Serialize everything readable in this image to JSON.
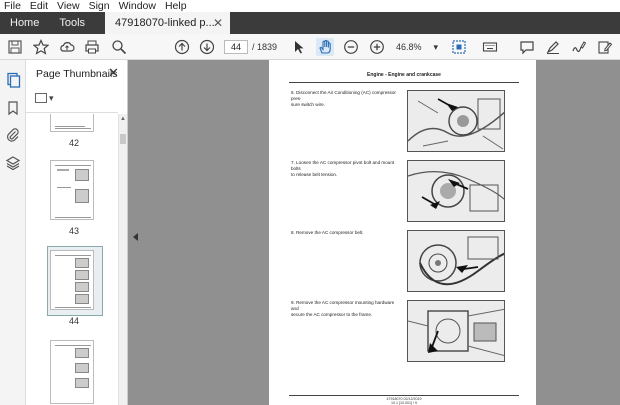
{
  "menu": [
    "File",
    "Edit",
    "View",
    "Sign",
    "Window",
    "Help"
  ],
  "tabs": {
    "home": "Home",
    "tools": "Tools",
    "document": "47918070-linked p...",
    "close": "✕"
  },
  "toolbar": {
    "page_current": "44",
    "page_total": "/  1839",
    "zoom": "46.8%",
    "zoom_caret": "▾"
  },
  "panel": {
    "title": "Page Thumbnails",
    "close": "✕",
    "thumbnails": [
      {
        "label": "42"
      },
      {
        "label": "43"
      },
      {
        "label": "44",
        "selected": true
      },
      {
        "label": ""
      }
    ]
  },
  "document": {
    "header": "Engine - Engine and crankcase",
    "steps": [
      {
        "text": "6.  Disconnect the Air Conditioning (AC) compressor pres-\n     sure switch wire."
      },
      {
        "text": "7.  Loosen the AC compressor pivot bolt and mount bolts\n     to release belt tension."
      },
      {
        "text": "8.  Remove the AC compressor belt."
      },
      {
        "text": "9.  Remove the AC compressor mounting hardware and\n     secure the AC compressor to the frame."
      }
    ],
    "footer": [
      "47918070 02/12/2019",
      "10.1 [10.001] / 9"
    ]
  }
}
